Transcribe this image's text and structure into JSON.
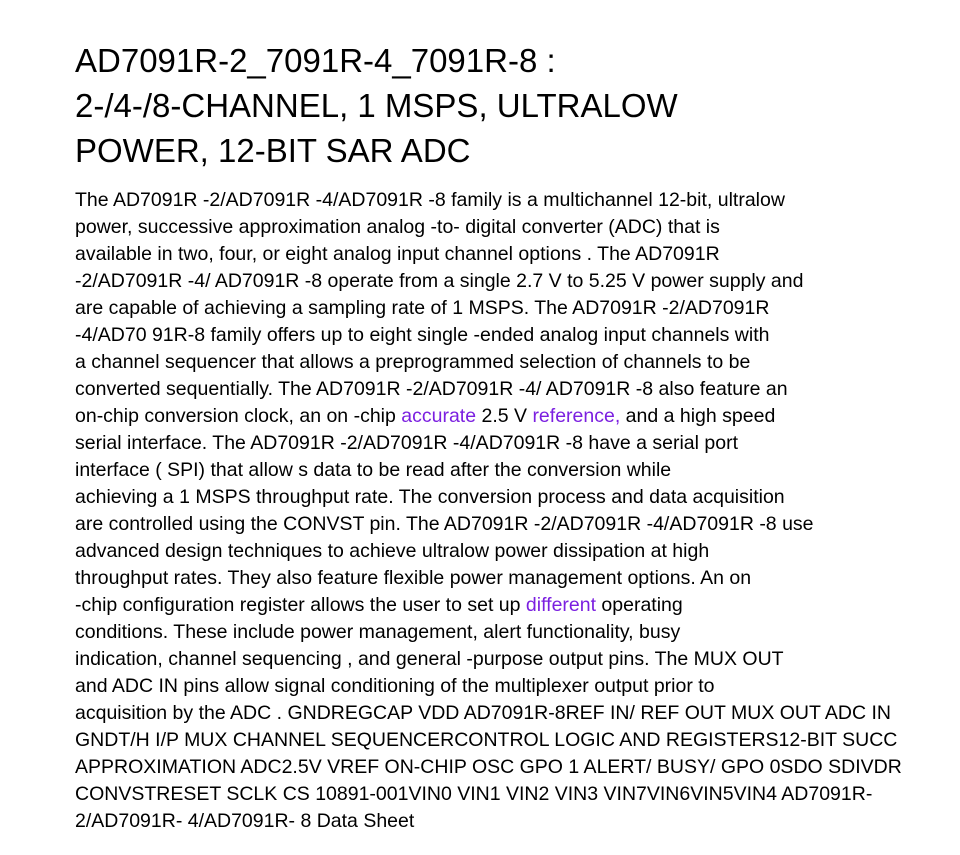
{
  "document": {
    "title_lines": [
      "AD7091R-2_7091R-4_7091R-8 :",
      "2-/4-/8-CHANNEL, 1 MSPS, ULTRALOW",
      "POWER, 12-BIT SAR ADC"
    ],
    "body_lines": [
      "The AD7091R -2/AD7091R -4/AD7091R -8 family is a multichannel 12-bit, ultralow",
      "power, successive approximation analog -to- digital converter (ADC) that is",
      "available in two, four, or eight analog input channel options . The AD7091R",
      "-2/AD7091R -4/ AD7091R -8 operate from a single 2.7 V to 5.25 V power supply and",
      "are capable of achieving a sampling rate of 1 MSPS. The AD7091R -2/AD7091R",
      "-4/AD70 91R-8 family offers up to eight single -ended analog input channels with",
      "a channel sequencer that allows a preprogrammed selection of channels to be",
      "converted sequentially. The AD7091R -2/AD7091R -4/ AD7091R -8 also feature an",
      {
        "before": "on-chip conversion clock, an on -chip ",
        "link1": "accurate",
        "middle": " 2.5 V ",
        "link2": "reference,",
        "after": " and a high speed"
      },
      "serial interface. The AD7091R -2/AD7091R -4/AD7091R -8 have a serial port",
      "interface ( SPI) that allow s data to be read after the conversion while",
      "achieving a 1 MSPS throughput rate. The conversion process and data acquisition",
      "are controlled using the CONVST pin. The AD7091R -2/AD7091R -4/AD7091R -8 use",
      "advanced design techniques to achieve ultralow power dissipation at high",
      "throughput rates. They also feature flexible power management options. An on",
      {
        "before": "-chip configuration register allows the user to set up ",
        "link1": "different",
        "after": " operating"
      },
      "conditions. These include power management, alert functionality, busy",
      "indication, channel sequencing , and general -purpose output pins. The MUX OUT",
      "and ADC IN pins allow signal conditioning of the multiplexer output prior to",
      "acquisition by the ADC . GNDREGCAP VDD AD7091R-8REF IN/ REF OUT MUX OUT ADC IN",
      "GNDT/H I/P MUX CHANNEL SEQUENCERCONTROL LOGIC AND REGISTERS12-BIT SUCC",
      "APPROXIMATION ADC2.5V VREF ON-CHIP OSC GPO 1 ALERT/ BUSY/ GPO 0SDO SDIVDR",
      "CONVSTRESET SCLK CS 10891-001VIN0 VIN1 VIN2 VIN3 VIN7VIN6VIN5VIN4 AD7091R-",
      "2/AD7091R- 4/AD7091R- 8 Data Sheet"
    ]
  },
  "colors": {
    "text": "#000000",
    "link": "#7b1fe0",
    "background": "#ffffff"
  }
}
